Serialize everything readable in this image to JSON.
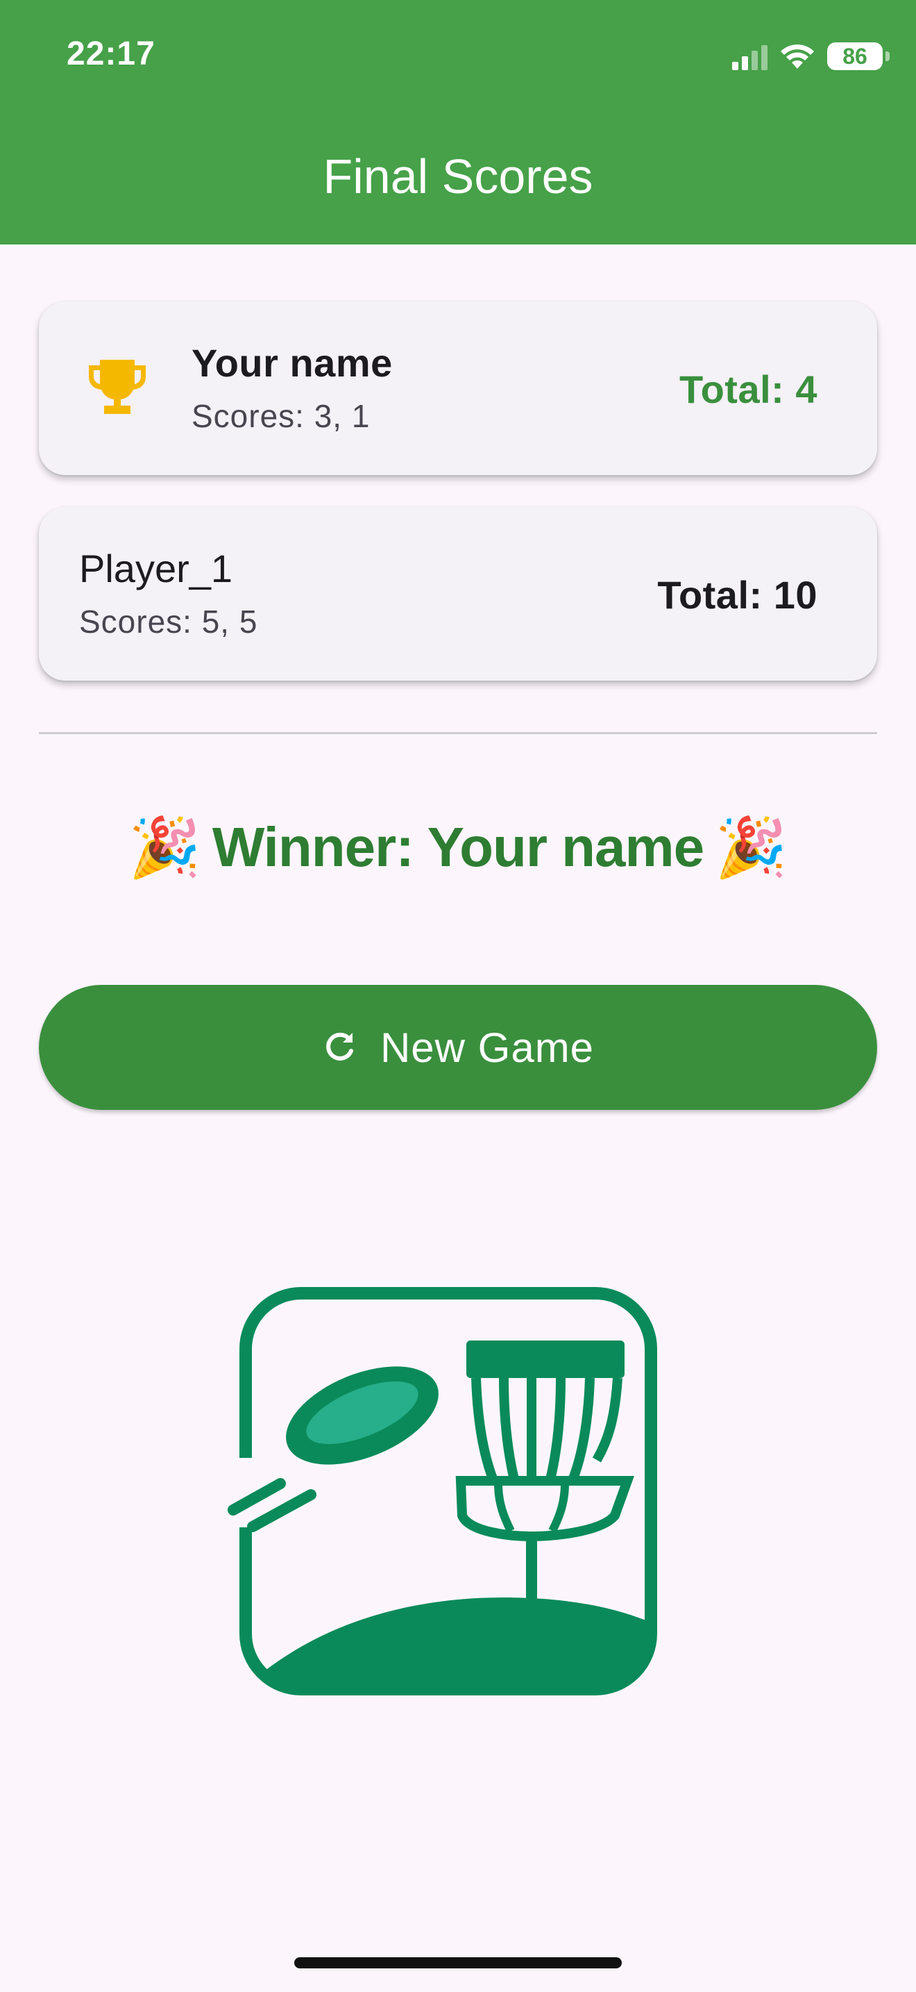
{
  "status_bar": {
    "time": "22:17",
    "battery": "86",
    "icons": [
      "cellular-signal-icon",
      "wifi-icon",
      "battery-icon"
    ]
  },
  "app_bar": {
    "title": "Final Scores"
  },
  "players": [
    {
      "name": "Your name",
      "scores": "Scores: 3, 1",
      "total": "Total: 4",
      "is_winner": true,
      "icon": "trophy-icon"
    },
    {
      "name": "Player_1",
      "scores": "Scores: 5, 5",
      "total": "Total: 10",
      "is_winner": false
    }
  ],
  "winner": {
    "text": "Winner: Your name",
    "emoji": "🎉"
  },
  "new_game_button": {
    "label": "New Game",
    "icon": "refresh-icon"
  },
  "logo": {
    "icon": "disc-golf-basket-logo"
  },
  "colors": {
    "app_bar": "#46a148",
    "accent_green": "#3a8f3d",
    "winner_text": "#2e7d32",
    "trophy": "#f5b800",
    "logo": "#0a8a5a",
    "background": "#fcf6fc",
    "card": "#f4f1f7"
  }
}
